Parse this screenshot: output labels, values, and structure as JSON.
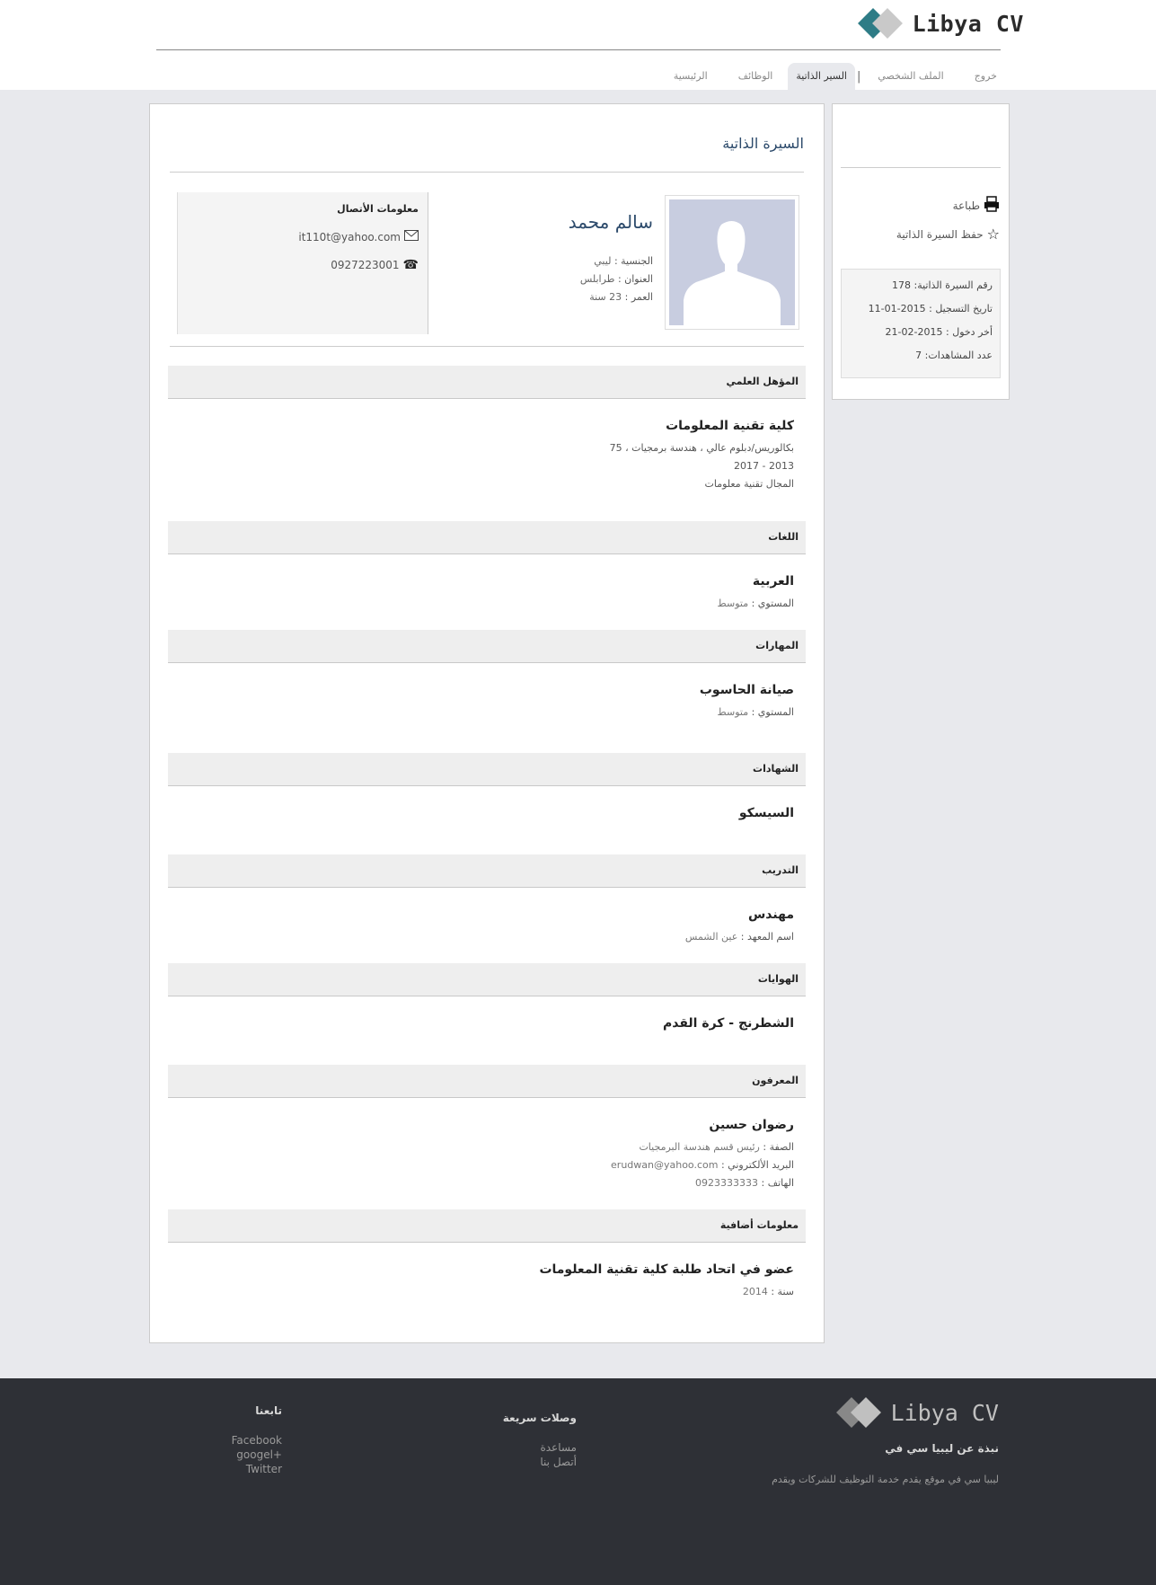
{
  "brand": {
    "name": "Libya CV"
  },
  "nav": {
    "home": "الرئيسية",
    "jobs": "الوظائف",
    "cvs": "السير الذاتية",
    "separator": "|",
    "profile": "الملف الشخصي",
    "logout": "خروج"
  },
  "page": {
    "title": "السيرة الذاتية"
  },
  "profile": {
    "name": "سالم محمد",
    "nationality_label": "الجنسية :",
    "nationality": "ليبي",
    "address_label": "العنوان :",
    "address": "طرابلس",
    "age_label": "العمر :",
    "age": "23 سنة"
  },
  "contact": {
    "title": "معلومات الأتصال",
    "email": "it110t@yahoo.com",
    "phone": "0927223001"
  },
  "education": {
    "heading": "المؤهل العلمي",
    "institution": "كلية تقنية المعلومات",
    "degree": "بكالوريس/دبلوم عالي ، هندسة برمجيات ، 75",
    "years": "2013 - 2017",
    "field": "المجال تقنية معلومات"
  },
  "languages": {
    "heading": "اللغات",
    "name": "العربية",
    "level_label": "المستوي :",
    "level": "متوسط"
  },
  "skills": {
    "heading": "المهارات",
    "name": "صيانة الحاسوب",
    "level_label": "المستوي :",
    "level": "متوسط"
  },
  "certificates": {
    "heading": "الشهادات",
    "name": "السيسكو"
  },
  "training": {
    "heading": "التدريب",
    "name": "مهندس",
    "institute_label": "اسم المعهد :",
    "institute": "عين الشمس"
  },
  "hobbies": {
    "heading": "الهوايات",
    "name": "الشطرنج - كرة القدم"
  },
  "references": {
    "heading": "المعرفون",
    "name": "رضوان حسين",
    "role_label": "الصفة :",
    "role": "رئيس قسم هندسة البرمجيات",
    "email_label": "البريد الألكتروني :",
    "email": "erudwan@yahoo.com",
    "phone_label": "الهاتف :",
    "phone": "0923333333"
  },
  "extra": {
    "heading": "معلومات أضافية",
    "name": "عضو في اتحاد طلبة كلية تقنية المعلومات",
    "year_label": "سنة :",
    "year": "2014"
  },
  "sidebar": {
    "print": "طباعة",
    "save": "حفظ السيرة الذاتية",
    "cv_number": "رقم السيرة الذاتية: 178",
    "registered": "تاريخ التسجيل : 2015-01-11",
    "last_login": "أخر دخول : 2015-02-21",
    "views": "عدد المشاهدات: 7"
  },
  "footer": {
    "about_title": "نبذة عن ليبيا سي في",
    "about_text": "ليبيا سي في موقع يقدم خدمة التوظيف للشركات ويقدم",
    "links_title": "وصلات سريعة",
    "link_help": "مساعدة",
    "link_contact": "أتصل بنا",
    "follow_title": "تابعنا",
    "facebook": "Facebook",
    "google": "googel+",
    "twitter": "Twitter"
  },
  "colors": {
    "accent": "#2e7c86",
    "title": "#2c4a6b",
    "footer_bg": "#2e3036",
    "page_bg": "#e8e9ed"
  }
}
